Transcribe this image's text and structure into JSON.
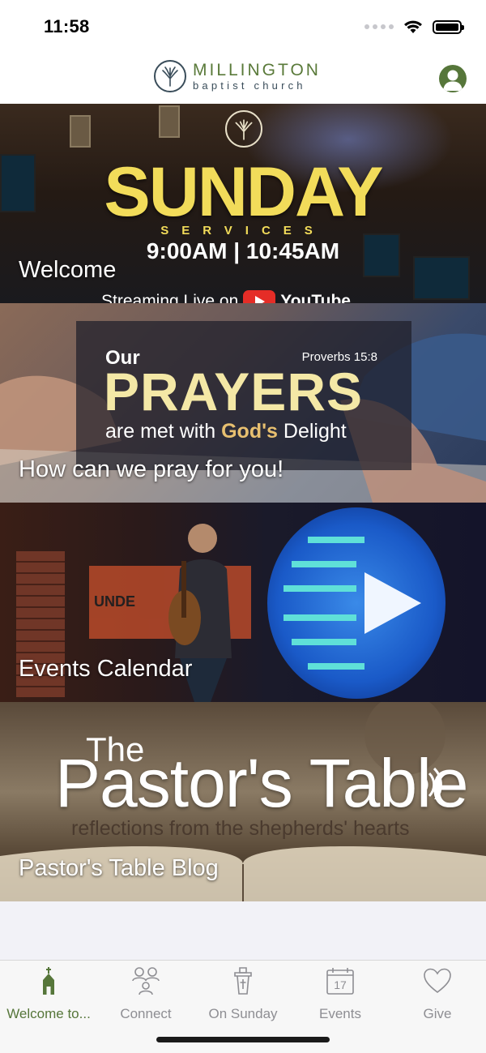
{
  "status_bar": {
    "time": "11:58"
  },
  "header": {
    "logo_line1": "MILLINGTON",
    "logo_line2": "baptist church",
    "profile_icon": "person-icon"
  },
  "tiles": [
    {
      "label": "Welcome",
      "art": {
        "title": "SUNDAY",
        "subtitle": "SERVICES",
        "times": "9:00AM | 10:45AM",
        "stream": "Streaming Live on",
        "stream_brand": "YouTube"
      }
    },
    {
      "label": "How can we pray for you!",
      "art": {
        "our": "Our",
        "verse": "Proverbs 15:8",
        "big": "PRAYERS",
        "sub_prefix": "are met with ",
        "sub_highlight": "God's",
        "sub_suffix": " Delight"
      }
    },
    {
      "label": "Events Calendar",
      "art": {
        "banner_text": "UNDE"
      }
    },
    {
      "label": "Pastor's Table Blog",
      "art": {
        "the": "The",
        "title": "Pastor's Table",
        "sub": "reflections from the shepherds' hearts"
      }
    }
  ],
  "tab_bar": {
    "active_color": "#56763a",
    "inactive_color": "#8e8e93",
    "tabs": [
      {
        "label": "Welcome to...",
        "icon": "church-icon",
        "active": true
      },
      {
        "label": "Connect",
        "icon": "people-icon",
        "active": false
      },
      {
        "label": "On Sunday",
        "icon": "pulpit-icon",
        "active": false
      },
      {
        "label": "Events",
        "icon": "calendar-icon",
        "active": false,
        "icon_text": "17"
      },
      {
        "label": "Give",
        "icon": "heart-icon",
        "active": false
      }
    ]
  }
}
